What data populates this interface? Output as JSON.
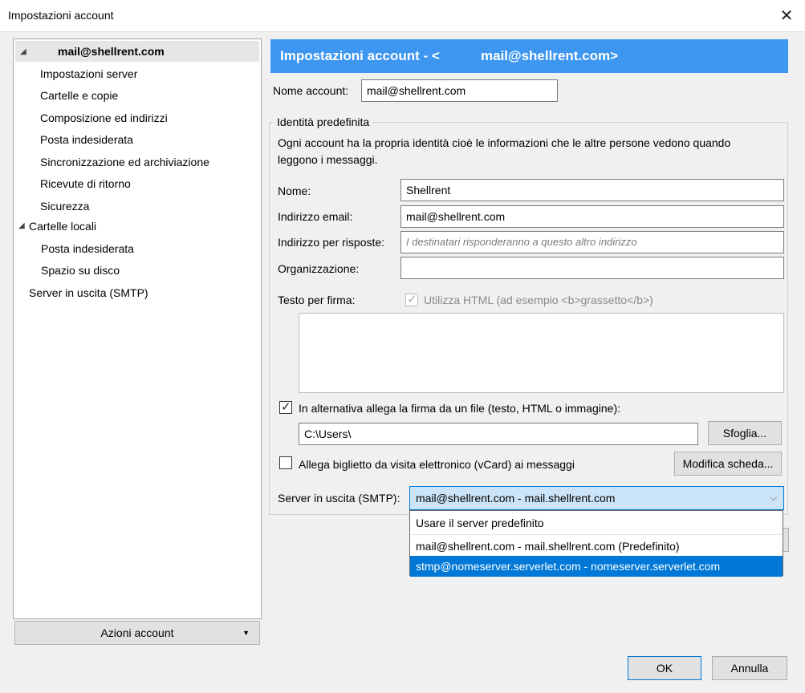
{
  "window": {
    "title": "Impostazioni account",
    "close_glyph": "✕"
  },
  "tree": {
    "account": "mail@shellrent.com",
    "account_items": [
      "Impostazioni server",
      "Cartelle e copie",
      "Composizione ed indirizzi",
      "Posta indesiderata",
      "Sincronizzazione ed archiviazione",
      "Ricevute di ritorno",
      "Sicurezza"
    ],
    "local_folders": "Cartelle locali",
    "local_items": [
      "Posta indesiderata",
      "Spazio su disco"
    ],
    "smtp": "Server in uscita (SMTP)"
  },
  "account_actions": "Azioni account",
  "header": {
    "prefix": "Impostazioni account - <",
    "account": "mail@shellrent.com>"
  },
  "account_name": {
    "label": "Nome account:",
    "value": "mail@shellrent.com"
  },
  "identity": {
    "legend": "Identità predefinita",
    "description_line1": "Ogni account ha la propria identità cioè le informazioni che le altre persone vedono quando",
    "description_line2": "leggono i messaggi.",
    "name_label": "Nome:",
    "name_value": "Shellrent",
    "email_label": "Indirizzo email:",
    "email_value": "mail@shellrent.com",
    "reply_label": "Indirizzo per risposte:",
    "reply_placeholder": "I destinatari risponderanno a questo altro indirizzo",
    "org_label": "Organizzazione:",
    "org_value": "",
    "signature_label": "Testo per firma:",
    "use_html_label": "Utilizza HTML (ad esempio <b>grassetto</b>)",
    "attach_sig_label": "In alternativa allega la firma da un file (testo, HTML o immagine):",
    "sig_path": "C:\\Users\\",
    "browse_label": "Sfoglia...",
    "vcard_label": "Allega biglietto da visita elettronico (vCard) ai messaggi",
    "edit_card_label": "Modifica scheda...",
    "smtp_label": "Server in uscita (SMTP):",
    "smtp_selected": "mail@shellrent.com - mail.shellrent.com",
    "smtp_options": [
      "Usare il server predefinito",
      "mail@shellrent.com - mail.shellrent.com (Predefinito)",
      "stmp@nomeserver.serverlet.com - nomeserver.serverlet.com"
    ],
    "smtp_highlighted_index": 2
  },
  "buttons": {
    "ok": "OK",
    "cancel": "Annulla"
  },
  "colors": {
    "header_blue": "#3d96f0",
    "highlight_blue": "#0078d7",
    "select_bg": "#cce4f7"
  }
}
